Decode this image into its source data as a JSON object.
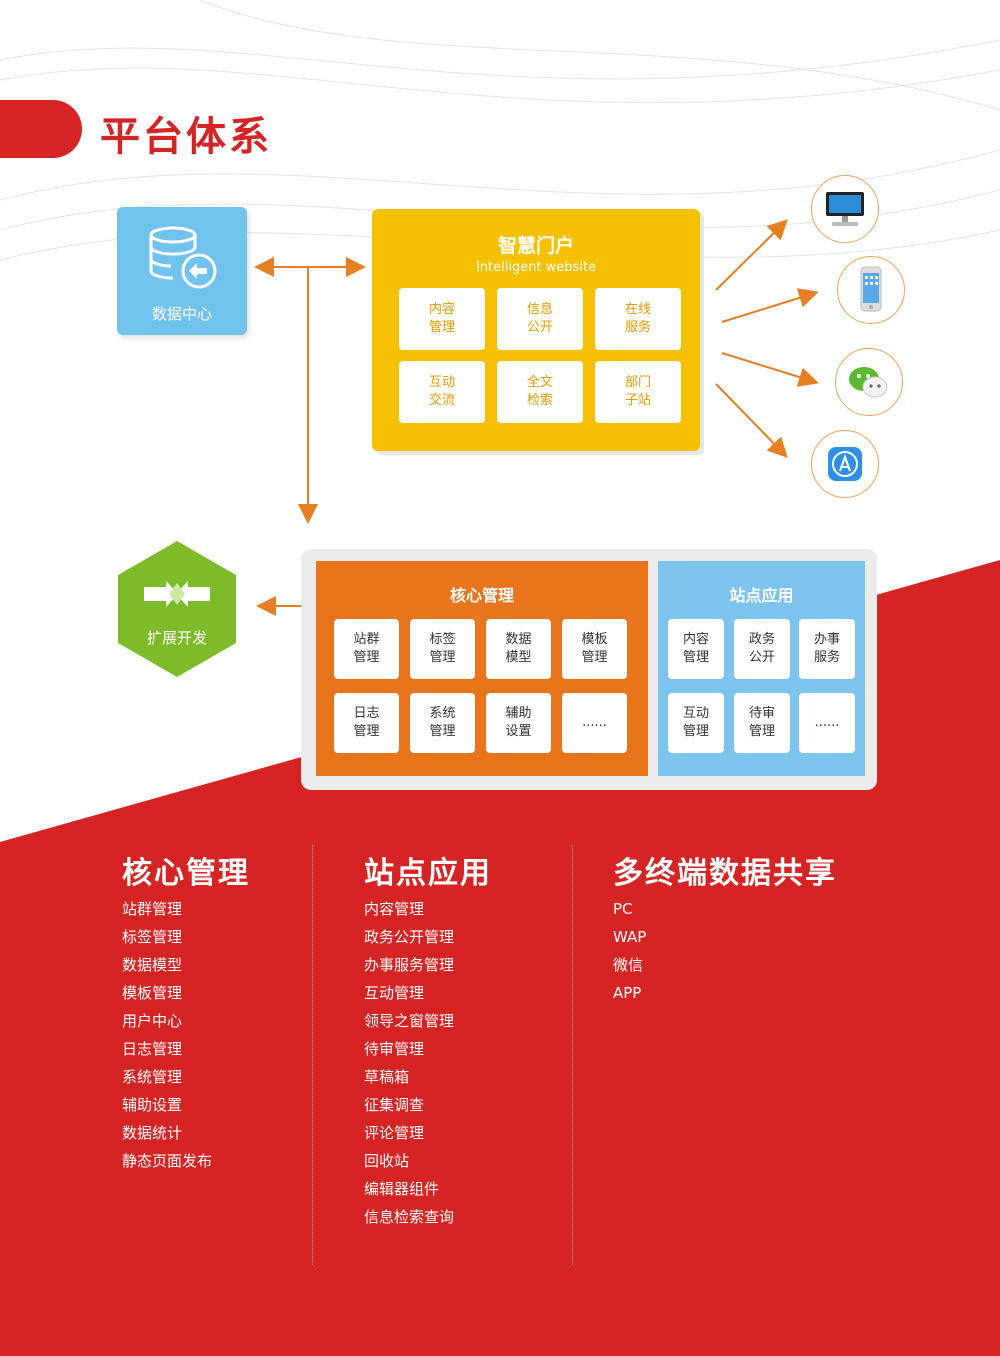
{
  "page_title": "平台体系",
  "data_center": {
    "label": "数据中心",
    "icon": "database-arrow-icon"
  },
  "portal": {
    "title": "智慧门户",
    "subtitle": "Intelligent website",
    "tiles": [
      "内容\n管理",
      "信息\n公开",
      "在线\n服务",
      "互动\n交流",
      "全文\n检索",
      "部门\n子站"
    ]
  },
  "devices": [
    "pc-monitor-icon",
    "phone-icon",
    "wechat-icon",
    "app-store-icon"
  ],
  "extension": {
    "label": "扩展开发",
    "icon": "arrows-converge-icon"
  },
  "core": {
    "title": "核心管理",
    "tiles": [
      "站群\n管理",
      "标签\n管理",
      "数据\n模型",
      "模板\n管理",
      "日志\n管理",
      "系统\n管理",
      "辅助\n设置",
      "......"
    ]
  },
  "site": {
    "title": "站点应用",
    "tiles": [
      "内容\n管理",
      "政务\n公开",
      "办事\n服务",
      "互动\n管理",
      "待审\n管理",
      "......"
    ]
  },
  "columns": [
    {
      "title": "核心管理",
      "items": [
        "站群管理",
        "标签管理",
        "数据模型",
        "模板管理",
        "用户中心",
        "日志管理",
        "系统管理",
        "辅助设置",
        "数据统计",
        "静态页面发布"
      ]
    },
    {
      "title": "站点应用",
      "items": [
        "内容管理",
        "政务公开管理",
        "办事服务管理",
        "互动管理",
        "领导之窗管理",
        "待审管理",
        "草稿箱",
        "征集调查",
        "评论管理",
        "回收站",
        "编辑器组件",
        "信息检索查询"
      ]
    },
    {
      "title": "多终端数据共享",
      "items": [
        "PC",
        "WAP",
        "微信",
        "APP"
      ]
    }
  ],
  "colors": {
    "brand_red": "#d62424",
    "portal_yellow": "#f5c000",
    "core_orange": "#e8741c",
    "site_blue": "#7cc4ee",
    "ext_green": "#7dbb2a",
    "arrow": "#e67e22"
  }
}
